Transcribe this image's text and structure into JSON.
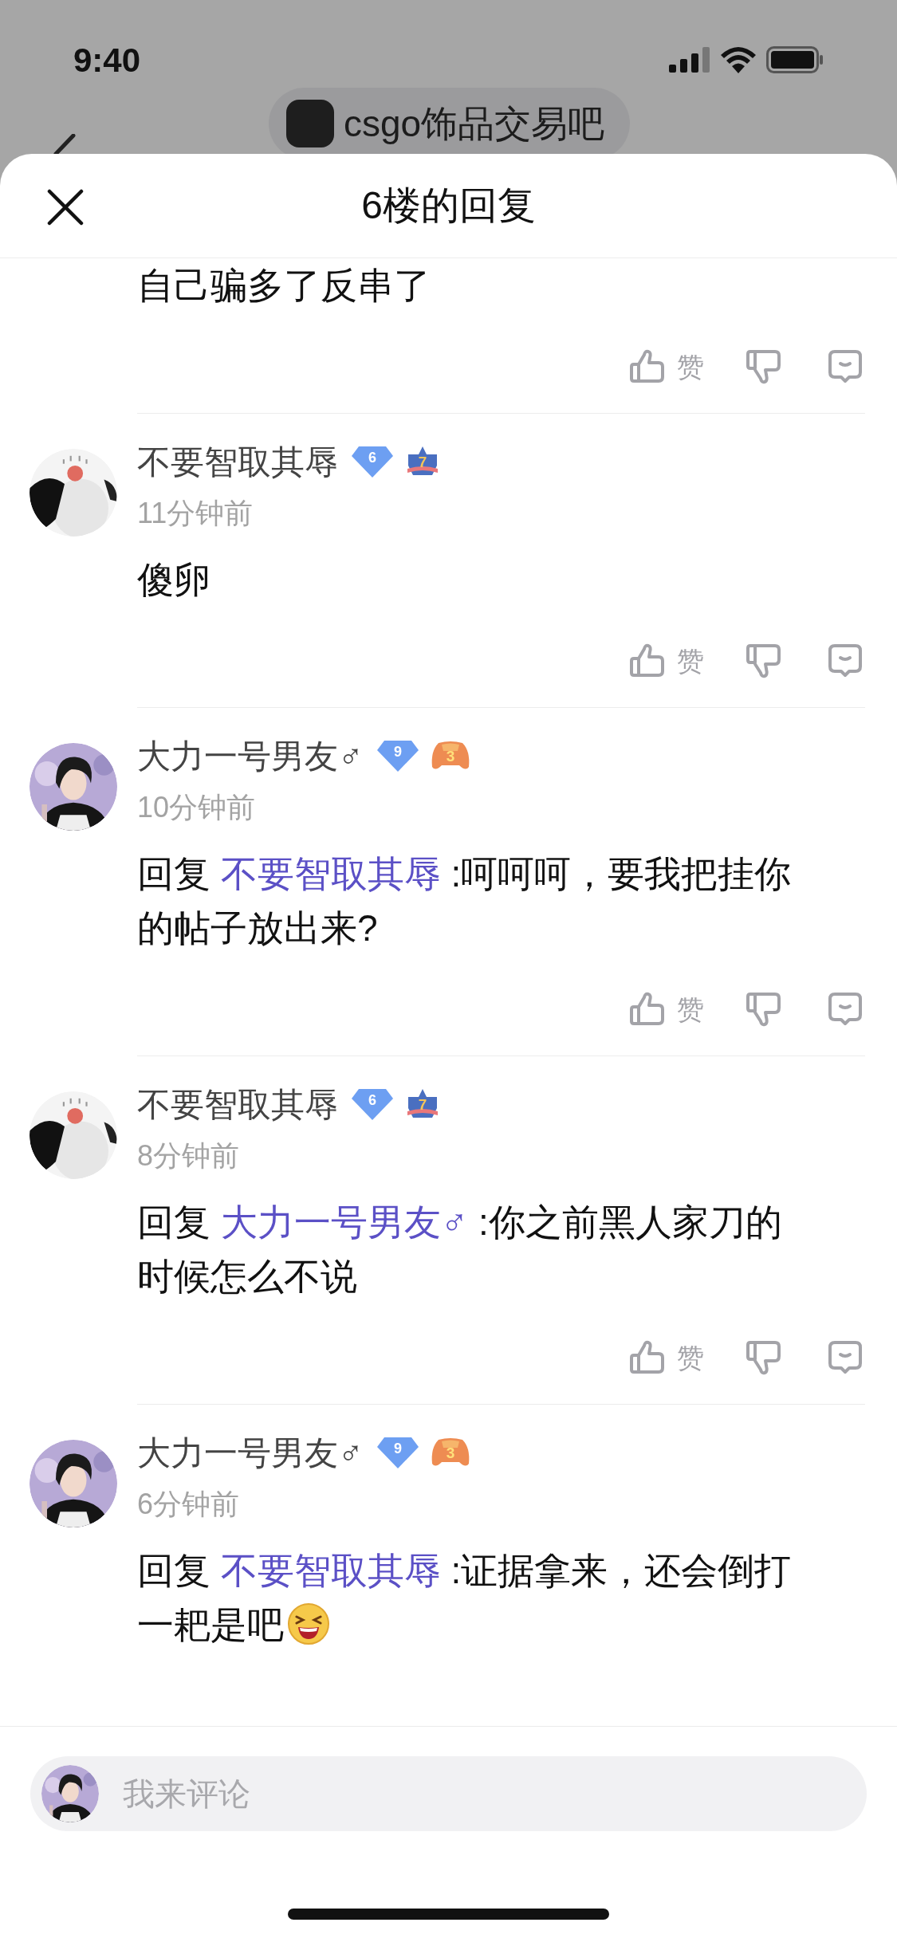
{
  "status_bar": {
    "time": "9:40"
  },
  "background_header": {
    "forum_name": "csgo饰品交易吧"
  },
  "sheet": {
    "title": "6楼的回复"
  },
  "comments": [
    {
      "kind": "partial",
      "body": {
        "text": "自己骗多了反串了"
      },
      "actions": {
        "like_label": "赞"
      }
    },
    {
      "kind": "full",
      "avatar": {
        "kind": "panda"
      },
      "author": "不要智取其辱",
      "badges": [
        {
          "kind": "diamond",
          "rank": "6"
        },
        {
          "kind": "star",
          "rank": "7"
        }
      ],
      "time": "11分钟前",
      "body": {
        "text": "傻卵"
      },
      "actions": {
        "like_label": "赞"
      }
    },
    {
      "kind": "full",
      "avatar": {
        "kind": "person"
      },
      "author": "大力一号男友♂",
      "badges": [
        {
          "kind": "diamond",
          "rank": "9"
        },
        {
          "kind": "controller",
          "rank": "3"
        }
      ],
      "time": "10分钟前",
      "body": {
        "prefix": "回复",
        "reply_to": "不要智取其辱",
        "text": ":呵呵呵，要我把挂你的帖子放出来?"
      },
      "actions": {
        "like_label": "赞"
      }
    },
    {
      "kind": "full",
      "avatar": {
        "kind": "panda"
      },
      "author": "不要智取其辱",
      "badges": [
        {
          "kind": "diamond",
          "rank": "6"
        },
        {
          "kind": "star",
          "rank": "7"
        }
      ],
      "time": "8分钟前",
      "body": {
        "prefix": "回复",
        "reply_to": "大力一号男友♂",
        "text": " :你之前黑人家刀的时候怎么不说"
      },
      "actions": {
        "like_label": "赞"
      }
    },
    {
      "kind": "full",
      "avatar": {
        "kind": "person"
      },
      "author": "大力一号男友♂",
      "badges": [
        {
          "kind": "diamond",
          "rank": "9"
        },
        {
          "kind": "controller",
          "rank": "3"
        }
      ],
      "time": "6分钟前",
      "body": {
        "prefix": "回复",
        "reply_to": "不要智取其辱",
        "text": ":证据拿来，还会倒打一耙是吧",
        "emoji": {
          "kind": "laughing"
        }
      }
    }
  ],
  "comment_bar": {
    "avatar": {
      "kind": "person"
    },
    "placeholder": "我来评论"
  }
}
